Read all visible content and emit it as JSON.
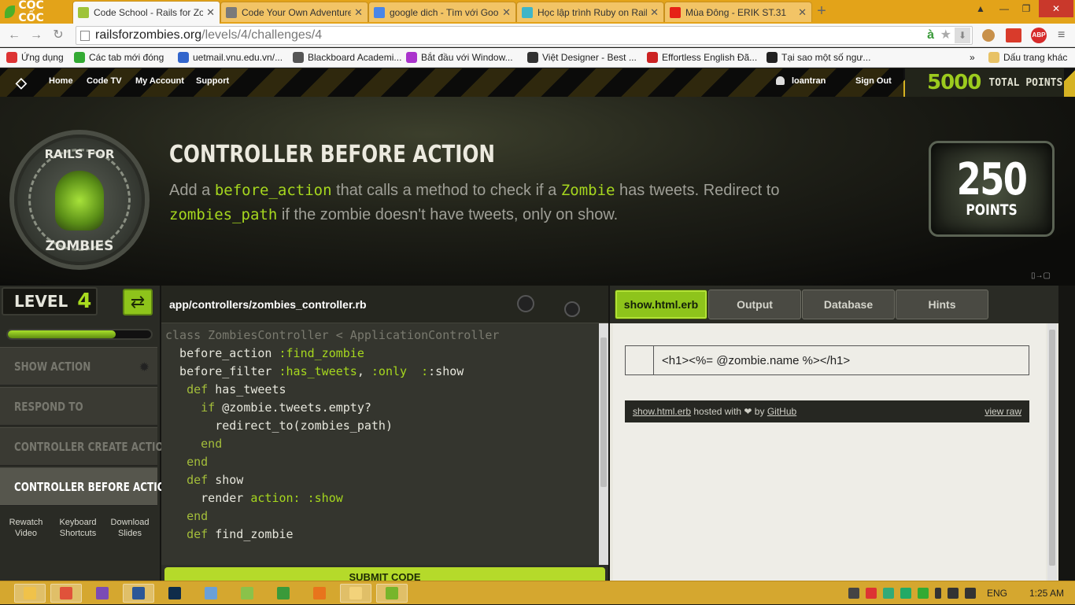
{
  "browser": {
    "brand": "CỐC CỐC",
    "tabs": [
      {
        "title": "Code School - Rails for Zo",
        "color": "#9ec33a",
        "active": true
      },
      {
        "title": "Code Your Own Adventure",
        "color": "#7a7a7a",
        "active": false
      },
      {
        "title": "google dich - Tìm với Goo",
        "color": "#4a86e8",
        "active": false
      },
      {
        "title": "Học lập trình Ruby on Rail",
        "color": "#3fb5c8",
        "active": false
      },
      {
        "title": "Mùa Đông - ERIK ST.31",
        "color": "#e62117",
        "active": false
      }
    ],
    "url": {
      "domain": "railsforzombies.org",
      "path": "/levels/4/challenges/4"
    },
    "bookmarks": [
      {
        "label": "Ứng dụng",
        "color": "#d33"
      },
      {
        "label": "Các tab mới đóng",
        "color": "#3a3"
      },
      {
        "label": "uetmail.vnu.edu.vn/...",
        "color": "#36c"
      },
      {
        "label": "Blackboard Academi...",
        "color": "#555"
      },
      {
        "label": "Bắt đầu với Window...",
        "color": "#a3c"
      },
      {
        "label": "Việt Designer - Best ...",
        "color": "#333"
      },
      {
        "label": "Effortless English Đã...",
        "color": "#c22"
      },
      {
        "label": "Tại sao một số ngư...",
        "color": "#222"
      }
    ],
    "bookmarks_more": "»",
    "bookmarks_folder": "Dấu trang khác"
  },
  "site": {
    "nav": [
      "Home",
      "Code TV",
      "My Account",
      "Support"
    ],
    "user": "loantran",
    "signout": "Sign Out",
    "total_points": "5000",
    "total_points_label": "TOTAL POINTS",
    "badge_top": "RAILS FOR",
    "badge_bottom": "ZOMBIES"
  },
  "challenge": {
    "title": "CONTROLLER BEFORE ACTION",
    "desc_parts": [
      {
        "t": "Add a ",
        "code": false
      },
      {
        "t": "before_action",
        "code": true
      },
      {
        "t": " that calls a method to check if a ",
        "code": false
      },
      {
        "t": "Zombie",
        "code": true
      },
      {
        "t": " has tweets. Redirect to ",
        "code": false
      },
      {
        "t": "zombies_path",
        "code": true
      },
      {
        "t": " if the zombie doesn't have tweets, only on show.",
        "code": false
      }
    ],
    "points": "250",
    "points_label": "POINTS"
  },
  "sidebar": {
    "level_label": "LEVEL",
    "level_num": "4",
    "progress": 0.75,
    "steps": [
      "SHOW ACTION",
      "RESPOND TO",
      "CONTROLLER CREATE ACTION",
      "CONTROLLER BEFORE ACTION"
    ],
    "active_step": 3,
    "links": [
      {
        "l1": "Rewatch",
        "l2": "Video"
      },
      {
        "l1": "Keyboard",
        "l2": "Shortcuts"
      },
      {
        "l1": "Download",
        "l2": "Slides"
      }
    ]
  },
  "editor": {
    "filename": "app/controllers/zombies_controller.rb",
    "lines": [
      [
        [
          "cm",
          "class ZombiesController < ApplicationController"
        ]
      ],
      [
        [
          "",
          "  before_action "
        ],
        [
          "sym",
          ":find_zombie"
        ]
      ],
      [
        [
          "",
          "  before_filter "
        ],
        [
          "sym",
          ":has_tweets"
        ],
        [
          "",
          ", "
        ],
        [
          "sym",
          ":only"
        ],
        [
          "",
          "  "
        ],
        [
          "sym",
          ":"
        ],
        [
          "",
          ":show"
        ]
      ],
      [
        [
          "",
          ""
        ]
      ],
      [
        [
          "",
          "   "
        ],
        [
          "kw",
          "def"
        ],
        [
          "",
          " has_tweets"
        ]
      ],
      [
        [
          "",
          "     "
        ],
        [
          "kw",
          "if"
        ],
        [
          "",
          " @zombie.tweets.empty?"
        ]
      ],
      [
        [
          "",
          "       redirect_to(zombies_path)"
        ]
      ],
      [
        [
          "",
          "     "
        ],
        [
          "kw",
          "end"
        ]
      ],
      [
        [
          "",
          "   "
        ],
        [
          "kw",
          "end"
        ]
      ],
      [
        [
          "",
          "   "
        ],
        [
          "kw",
          "def"
        ],
        [
          "",
          " show"
        ]
      ],
      [
        [
          "",
          "     render "
        ],
        [
          "sym",
          "action:"
        ],
        [
          "",
          " "
        ],
        [
          "sym",
          ":show"
        ]
      ],
      [
        [
          "",
          "   "
        ],
        [
          "kw",
          "end"
        ]
      ],
      [
        [
          "",
          "   "
        ],
        [
          "kw",
          "def"
        ],
        [
          "",
          " find_zombie"
        ]
      ]
    ],
    "submit_label": "SUBMIT CODE"
  },
  "panel": {
    "tabs": [
      "show.html.erb",
      "Output",
      "Database",
      "Hints"
    ],
    "active_tab": 0,
    "code_line": "<h1><%= @zombie.name %></h1>",
    "gist_file": "show.html.erb",
    "gist_hosted": " hosted with ❤ by ",
    "gist_host": "GitHub",
    "view_raw": "view raw"
  },
  "taskbar": {
    "apps": [
      {
        "name": "file-explorer-icon",
        "color": "#f0c24a",
        "open": true
      },
      {
        "name": "paint-icon",
        "color": "#e0523a",
        "open": true
      },
      {
        "name": "visual-studio-icon",
        "color": "#7b4bb5",
        "open": false
      },
      {
        "name": "word-icon",
        "color": "#2b5797",
        "open": true
      },
      {
        "name": "photoshop-icon",
        "color": "#0f2c4a",
        "open": false
      },
      {
        "name": "keyboard-icon",
        "color": "#6aa0d8",
        "open": false
      },
      {
        "name": "notepad-icon",
        "color": "#8ac24a",
        "open": false
      },
      {
        "name": "chrome-icon",
        "color": "#3a9a3a",
        "open": false
      },
      {
        "name": "firefox-icon",
        "color": "#e8741c",
        "open": false
      },
      {
        "name": "folder-icon",
        "color": "#f2d27a",
        "open": true
      },
      {
        "name": "coccoc-icon",
        "color": "#77b52b",
        "open": true
      }
    ],
    "lang": "ENG",
    "time": "1:25 AM"
  }
}
